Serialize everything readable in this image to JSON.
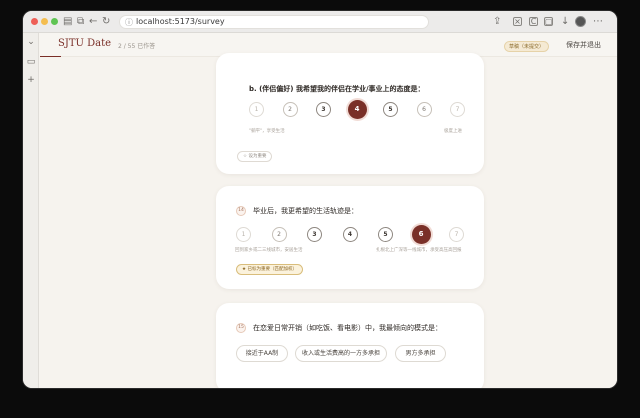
{
  "browser": {
    "url": "localhost:5173/survey",
    "icons": {
      "back": "←",
      "forward": "→",
      "reload": "↻",
      "sidebar_toggle": "▤",
      "tabs": "⧉",
      "lock": "ⓘ",
      "share": "⇪",
      "add_tab": "+",
      "overflow": "⋯",
      "download": "↓"
    }
  },
  "app": {
    "brand": "SJTU Date",
    "progress": "2 / 55 已作答",
    "progress_fraction": 0.036,
    "draft_badge": "草稿（未提交）",
    "save_exit": "保存并退出"
  },
  "colors": {
    "accent": "#7a3028",
    "background": "#f6f3ee",
    "card": "#ffffff",
    "highlight": "#fbf2dc"
  },
  "questions": {
    "q_partner": {
      "title": "b. (伴侣偏好) 我希望我的伴侣在学业/事业上的态度是：",
      "scale": [
        "1",
        "2",
        "3",
        "4",
        "5",
        "6",
        "7"
      ],
      "selected": "4",
      "left_label": "\"躺平\"，享受生活",
      "right_label": "极度上进",
      "mark_label": "☆ 设为重要"
    },
    "q14": {
      "number": "14",
      "title": "毕业后，我更希望的生活轨迹是：",
      "scale": [
        "1",
        "2",
        "3",
        "4",
        "5",
        "6",
        "7"
      ],
      "selected": "6",
      "left_label": "回到家乡或二三线城市，安居生活",
      "right_label": "扎根北上广深等一线城市，承受高压高回报",
      "mark_label": "★ 已标为重要（匹配加权）"
    },
    "q15": {
      "number": "15",
      "title": "在恋爱日常开销（如吃饭、看电影）中，我最倾向的模式是：",
      "options": [
        "接近于AA制",
        "收入或生活费高的一方多承担",
        "男方多承担"
      ]
    }
  }
}
